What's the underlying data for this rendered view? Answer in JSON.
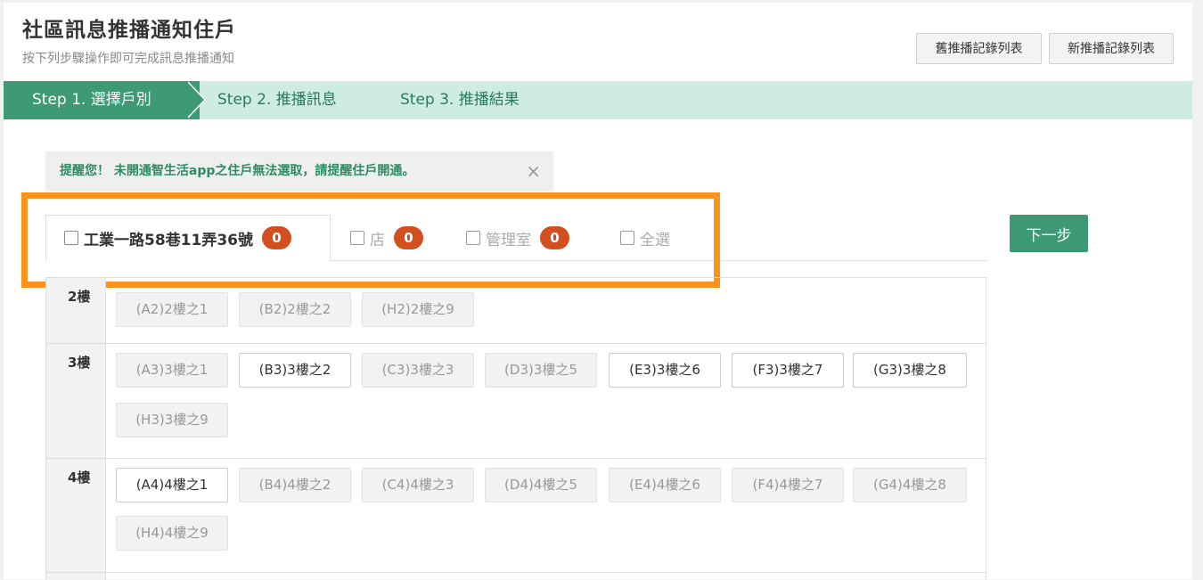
{
  "header": {
    "title": "社區訊息推播通知住戶",
    "subtitle": "按下列步驟操作即可完成訊息推播通知",
    "old_records_label": "舊推播記錄列表",
    "new_records_label": "新推播記錄列表"
  },
  "steps": [
    {
      "label": "Step 1. 選擇戶別",
      "active": true
    },
    {
      "label": "Step 2. 推播訊息",
      "active": false
    },
    {
      "label": "Step 3. 推播結果",
      "active": false
    }
  ],
  "alert": {
    "text": "提醒您！ 未開通智生活app之住戶無法選取，請提醒住戶開通。",
    "close_glyph": "×"
  },
  "tabs": [
    {
      "label": "工業一路58巷11弄36號",
      "count": "0",
      "active": true
    },
    {
      "label": "店",
      "count": "0",
      "active": false
    },
    {
      "label": "管理室",
      "count": "0",
      "active": false
    },
    {
      "label": "全選",
      "active": false
    }
  ],
  "next_button_label": "下一步",
  "floors": [
    {
      "label": "2樓",
      "units": [
        {
          "label": "(A2)2樓之1",
          "enabled": false
        },
        {
          "label": "(B2)2樓之2",
          "enabled": false
        },
        {
          "label": "(H2)2樓之9",
          "enabled": false
        }
      ]
    },
    {
      "label": "3樓",
      "units": [
        {
          "label": "(A3)3樓之1",
          "enabled": false
        },
        {
          "label": "(B3)3樓之2",
          "enabled": true
        },
        {
          "label": "(C3)3樓之3",
          "enabled": false
        },
        {
          "label": "(D3)3樓之5",
          "enabled": false
        },
        {
          "label": "(E3)3樓之6",
          "enabled": true
        },
        {
          "label": "(F3)3樓之7",
          "enabled": true
        },
        {
          "label": "(G3)3樓之8",
          "enabled": true
        },
        {
          "label": "(H3)3樓之9",
          "enabled": false
        }
      ]
    },
    {
      "label": "4樓",
      "units": [
        {
          "label": "(A4)4樓之1",
          "enabled": true
        },
        {
          "label": "(B4)4樓之2",
          "enabled": false
        },
        {
          "label": "(C4)4樓之3",
          "enabled": false
        },
        {
          "label": "(D4)4樓之5",
          "enabled": false
        },
        {
          "label": "(E4)4樓之6",
          "enabled": false
        },
        {
          "label": "(F4)4樓之7",
          "enabled": false
        },
        {
          "label": "(G4)4樓之8",
          "enabled": false
        },
        {
          "label": "(H4)4樓之9",
          "enabled": false
        }
      ]
    }
  ],
  "colors": {
    "accent": "#3e9a76",
    "step_bar": "#cfece3",
    "badge": "#d24f1f",
    "highlight": "#f7931e"
  }
}
